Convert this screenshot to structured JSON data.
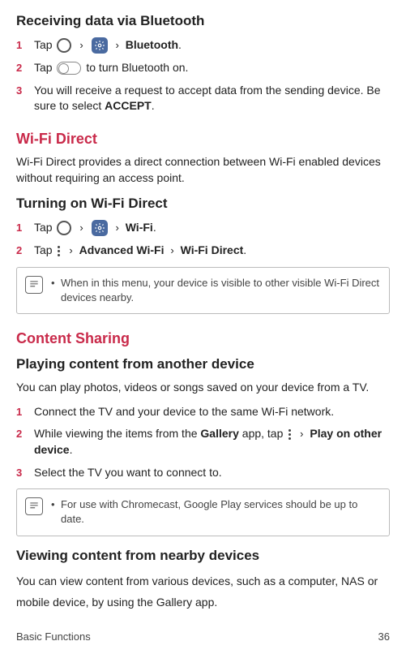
{
  "section1": {
    "heading": "Receiving data via Bluetooth",
    "step1_tap": "Tap",
    "step1_bluetooth": "Bluetooth",
    "step1_period": ".",
    "step2_tap": "Tap",
    "step2_rest": " to turn Bluetooth on.",
    "step3_a": "You will receive a request to accept data from the sending device. Be sure to select ",
    "step3_accept": "ACCEPT",
    "step3_b": "."
  },
  "section2": {
    "heading": "Wi-Fi Direct",
    "desc": "Wi-Fi Direct provides a direct connection between Wi-Fi enabled devices without requiring an access point.",
    "sub": "Turning on Wi-Fi Direct",
    "step1_tap": "Tap",
    "step1_wifi": "Wi-Fi",
    "step1_period": ".",
    "step2_tap": "Tap",
    "step2_adv": "Advanced Wi-Fi",
    "step2_direct": "Wi-Fi Direct",
    "step2_period": ".",
    "note": "When in this menu, your device is visible to other visible Wi-Fi Direct devices nearby."
  },
  "section3": {
    "heading": "Content Sharing",
    "sub1": "Playing content from another device",
    "desc1": "You can play photos, videos or songs saved on your device from a TV.",
    "step1": "Connect the TV and your device to the same Wi-Fi network.",
    "step2_a": "While viewing the items from the ",
    "step2_gallery": "Gallery",
    "step2_b": " app, tap ",
    "step2_play": "Play on other device",
    "step2_c": ".",
    "step3": "Select the TV you want to connect to.",
    "note": "For use with Chromecast, Google Play services should be up to date.",
    "sub2": "Viewing content from nearby devices",
    "desc2": "You can view content from various devices, such as a computer, NAS or mobile device, by using the Gallery app."
  },
  "footer": {
    "left": "Basic Functions",
    "right": "36"
  },
  "glyph": {
    "chevron": "›"
  }
}
